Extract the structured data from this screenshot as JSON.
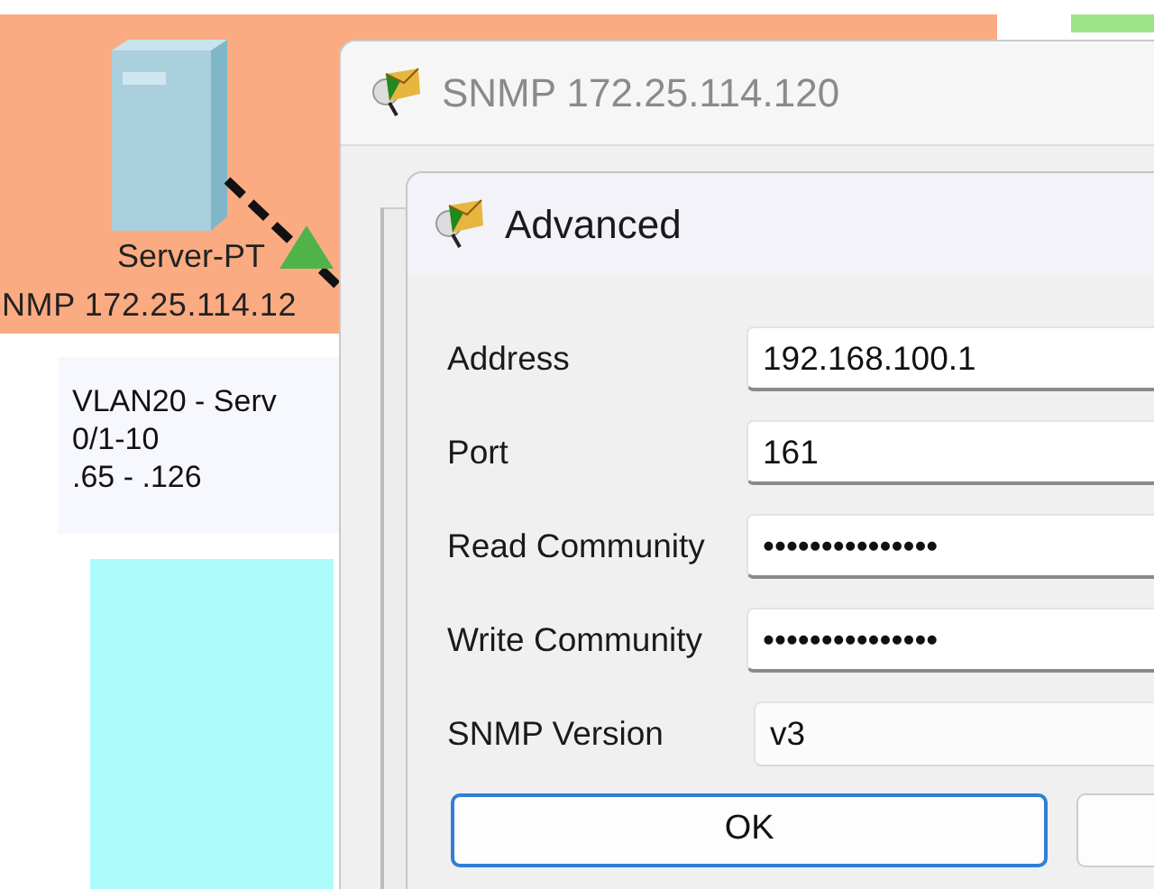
{
  "canvas": {
    "areas": [
      {
        "kind": "zone",
        "color": "#fbab82"
      },
      {
        "kind": "strip",
        "color": "#9ee58a"
      },
      {
        "kind": "block",
        "color": "#acfcfc"
      }
    ],
    "devices": [
      {
        "label": "Server-PT",
        "sublabel": "NMP 172.25.114.12"
      }
    ],
    "note": {
      "lines": [
        "VLAN20 - Serv",
        "0/1-10",
        ".65 - .126"
      ]
    }
  },
  "snmp_window": {
    "title": "SNMP 172.25.114.120"
  },
  "advanced_dialog": {
    "title": "Advanced",
    "fields": [
      {
        "label": "Address",
        "value": "192.168.100.1",
        "kind": "text"
      },
      {
        "label": "Port",
        "value": "161",
        "kind": "text"
      },
      {
        "label": "Read Community",
        "value": "•••••••••••••••",
        "kind": "text"
      },
      {
        "label": "Write Community",
        "value": "•••••••••••••••",
        "kind": "text"
      },
      {
        "label": "SNMP Version",
        "value": "v3",
        "kind": "select"
      }
    ],
    "buttons": [
      {
        "label": "OK",
        "default": true
      }
    ]
  }
}
